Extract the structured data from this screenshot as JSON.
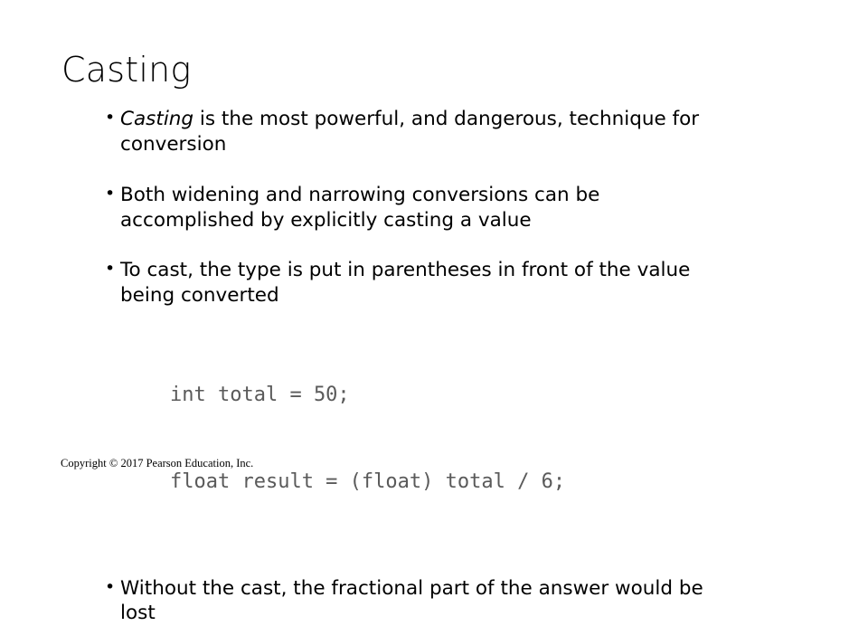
{
  "slide": {
    "title": "Casting",
    "bullets": [
      {
        "id": "bullet-casting-powerful",
        "emphasis": "Casting",
        "text": " is the most powerful, and dangerous, technique for conversion"
      },
      {
        "id": "bullet-widening-narrowing",
        "text": "Both widening and narrowing conversions can be accomplished by explicitly casting a value"
      },
      {
        "id": "bullet-to-cast",
        "text": "To cast, the type is put in parentheses in front of the value being converted"
      },
      {
        "id": "bullet-without-cast",
        "text": "Without the cast, the fractional part of the answer would be lost"
      }
    ],
    "code": {
      "line1": "int total = 50;",
      "line2": "float result = (float) total / 6;"
    },
    "copyright": "Copyright © 2017 Pearson Education, Inc."
  }
}
